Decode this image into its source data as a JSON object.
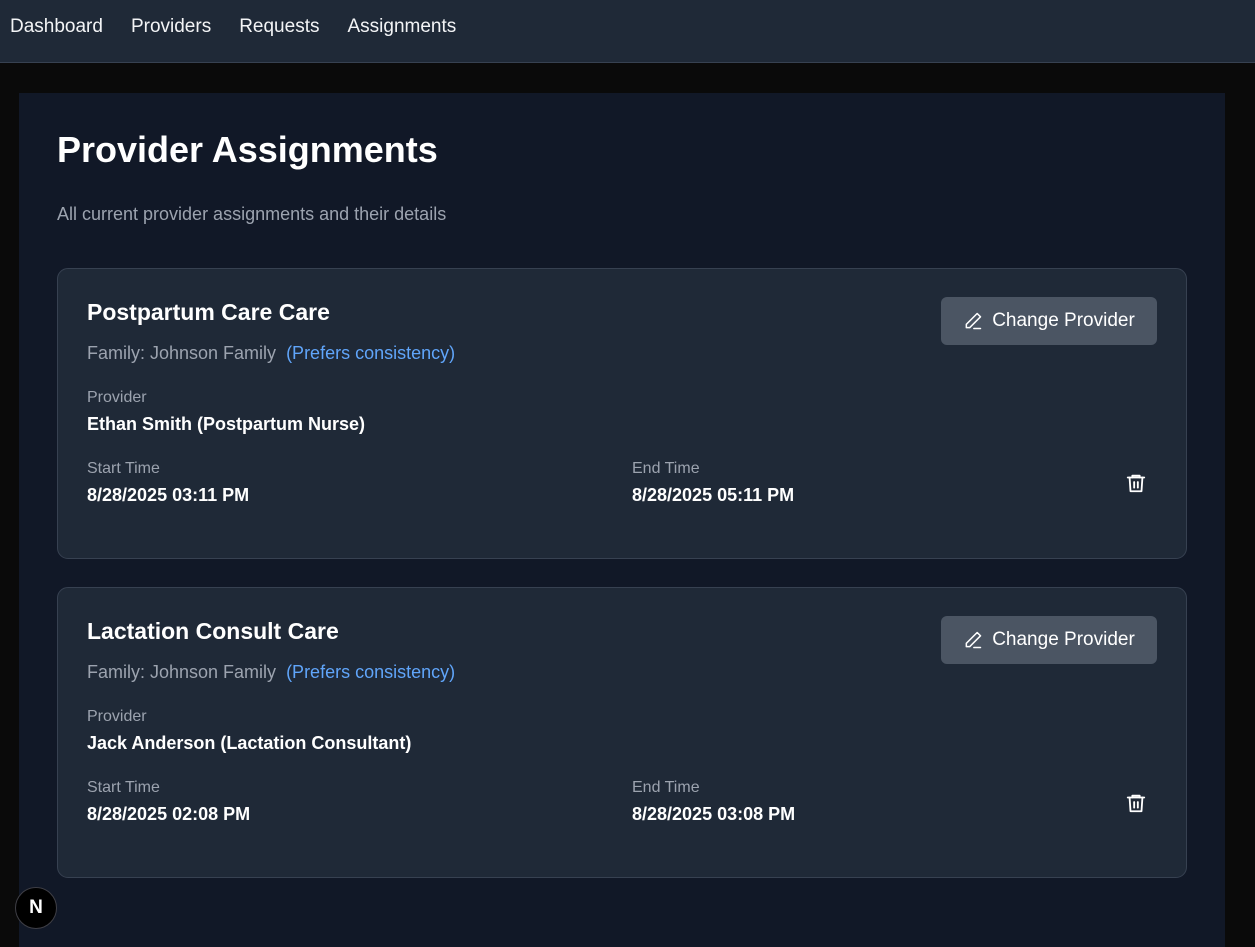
{
  "nav": {
    "items": [
      {
        "label": "Dashboard"
      },
      {
        "label": "Providers"
      },
      {
        "label": "Requests"
      },
      {
        "label": "Assignments"
      }
    ]
  },
  "page": {
    "title": "Provider Assignments",
    "subtitle": "All current provider assignments and their details"
  },
  "labels": {
    "change_button": "Change Provider",
    "provider": "Provider",
    "start_time": "Start Time",
    "end_time": "End Time"
  },
  "assignments": [
    {
      "title": "Postpartum Care Care",
      "family": "Family: Johnson Family",
      "preference": "(Prefers consistency)",
      "provider": "Ethan Smith (Postpartum Nurse)",
      "start": "8/28/2025 03:11 PM",
      "end": "8/28/2025 05:11 PM"
    },
    {
      "title": "Lactation Consult Care",
      "family": "Family: Johnson Family",
      "preference": "(Prefers consistency)",
      "provider": "Jack Anderson (Lactation Consultant)",
      "start": "8/28/2025 02:08 PM",
      "end": "8/28/2025 03:08 PM"
    }
  ],
  "badge": {
    "letter": "N"
  },
  "icons": {
    "change": "pencil-icon",
    "delete": "trash-icon"
  },
  "colors": {
    "nav_bg": "#1f2937",
    "panel_bg": "#111827",
    "card_bg": "#1f2937",
    "button_bg": "#4b5563",
    "accent_link": "#60a5fa",
    "muted_text": "#9ca3af"
  }
}
